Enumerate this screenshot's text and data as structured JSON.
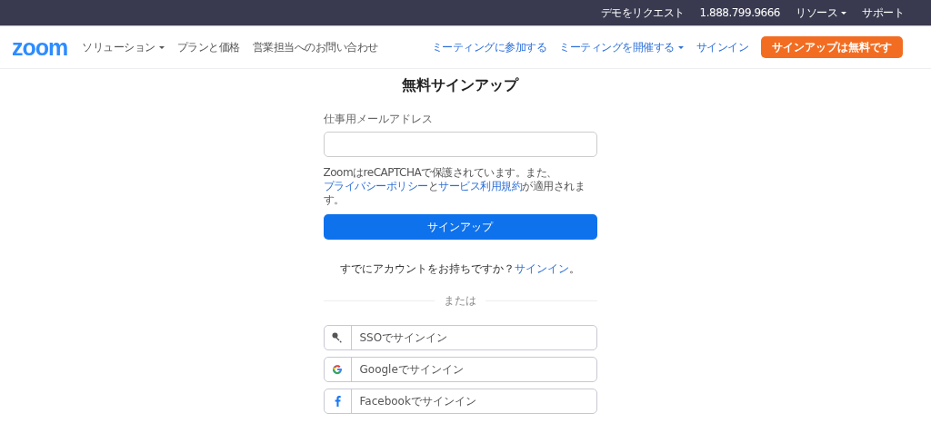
{
  "top_bar": {
    "links": [
      {
        "text": "デモをリクエスト",
        "dropdown": false
      },
      {
        "text": "1.888.799.9666",
        "dropdown": false
      },
      {
        "text": "リソース",
        "dropdown": true
      },
      {
        "text": "サポート",
        "dropdown": false
      }
    ]
  },
  "nav": {
    "logo": "zoom",
    "left_links": [
      {
        "text": "ソリューション",
        "dropdown": true
      },
      {
        "text": "プランと価格",
        "dropdown": false
      },
      {
        "text": "営業担当へのお問い合わせ",
        "dropdown": false
      }
    ],
    "right_links": [
      {
        "text": "ミーティングに参加する",
        "dropdown": false
      },
      {
        "text": "ミーティングを開催する",
        "dropdown": true
      },
      {
        "text": "サインイン",
        "dropdown": false
      }
    ],
    "cta": "サインアップは無料です"
  },
  "form": {
    "title": "無料サインアップ",
    "email_label": "仕事用メールアドレス",
    "notice": [
      {
        "kind": "text",
        "text": "ZoomはreCAPTCHAで保護されています。また、"
      },
      {
        "kind": "link",
        "text": "プライバシーポリシー"
      },
      {
        "kind": "text",
        "text": "と"
      },
      {
        "kind": "link",
        "text": "サービス利用規約"
      },
      {
        "kind": "text",
        "text": "が適用されます。"
      }
    ],
    "submit": "サインアップ",
    "signin_prompt": [
      {
        "kind": "text",
        "text": "すでにアカウントをお持ちですか？"
      },
      {
        "kind": "link",
        "text": "サインイン"
      },
      {
        "kind": "text",
        "text": "。"
      }
    ],
    "divider": "または",
    "sso_buttons": [
      {
        "kind": "key",
        "text": "SSOでサインイン"
      },
      {
        "kind": "google",
        "text": "Googleでサインイン"
      },
      {
        "kind": "facebook",
        "text": "Facebookでサインイン"
      }
    ]
  }
}
